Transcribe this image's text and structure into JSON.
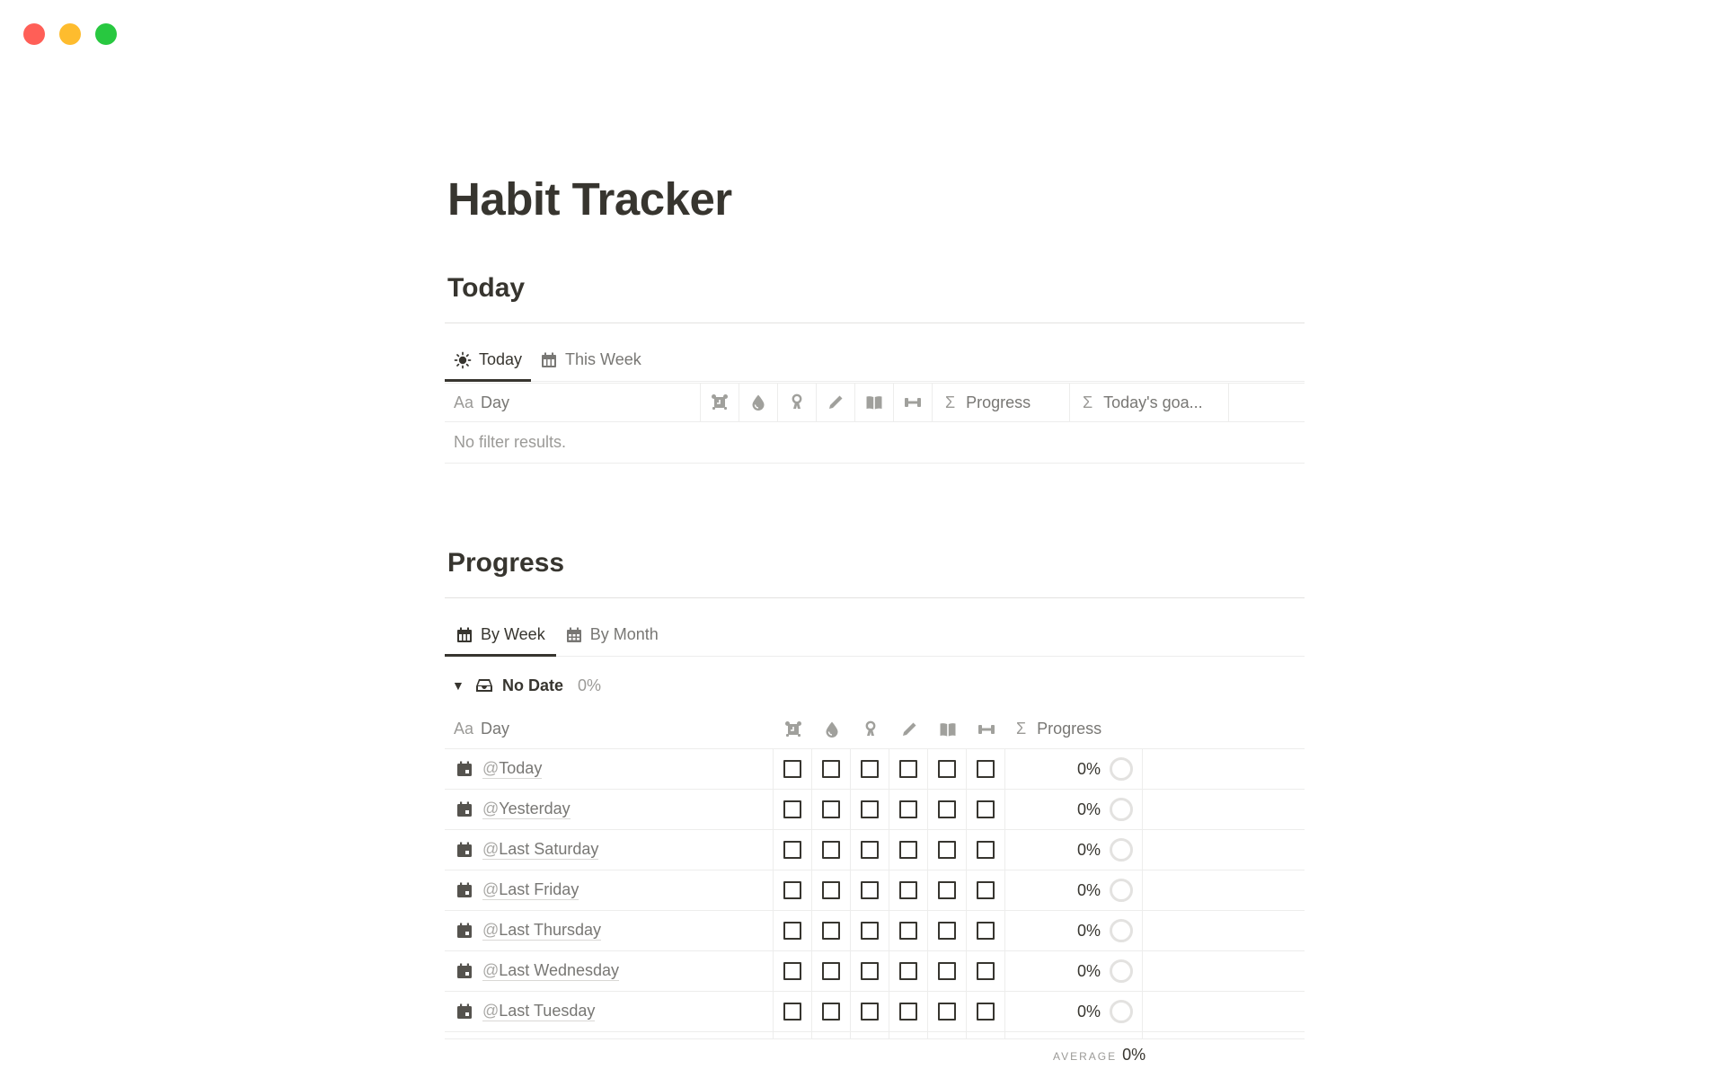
{
  "window": {
    "controls": [
      {
        "name": "close",
        "color": "#ff5f57"
      },
      {
        "name": "minimize",
        "color": "#febc2e"
      },
      {
        "name": "zoom",
        "color": "#28c840"
      }
    ]
  },
  "page": {
    "title": "Habit Tracker"
  },
  "today_section": {
    "heading": "Today",
    "tabs": [
      {
        "label": "Today",
        "icon": "sun-icon",
        "active": true
      },
      {
        "label": "This Week",
        "icon": "calendar-week-icon",
        "active": false
      }
    ],
    "columns": {
      "day_prefix": "Aa",
      "day": "Day",
      "habit_icons": [
        "alarm-clock-icon",
        "water-drop-icon",
        "meditation-icon",
        "pencil-icon",
        "book-icon",
        "dumbbell-icon"
      ],
      "progress_symbol": "Σ",
      "progress": "Progress",
      "goal_symbol": "Σ",
      "goal": "Today's goa..."
    },
    "empty_text": "No filter results."
  },
  "progress_section": {
    "heading": "Progress",
    "tabs": [
      {
        "label": "By Week",
        "icon": "calendar-week-icon",
        "active": true
      },
      {
        "label": "By Month",
        "icon": "calendar-month-icon",
        "active": false
      }
    ],
    "group": {
      "caret": "▼",
      "icon": "inbox-icon",
      "name": "No Date",
      "percent": "0%"
    },
    "columns": {
      "day_prefix": "Aa",
      "day": "Day",
      "habit_icons": [
        "alarm-clock-icon",
        "water-drop-icon",
        "meditation-icon",
        "pencil-icon",
        "book-icon",
        "dumbbell-icon"
      ],
      "progress_symbol": "Σ",
      "progress": "Progress"
    },
    "rows": [
      {
        "at": "@",
        "day": "Today",
        "checks": [
          false,
          false,
          false,
          false,
          false,
          false
        ],
        "progress": "0%"
      },
      {
        "at": "@",
        "day": "Yesterday",
        "checks": [
          false,
          false,
          false,
          false,
          false,
          false
        ],
        "progress": "0%"
      },
      {
        "at": "@",
        "day": "Last Saturday",
        "checks": [
          false,
          false,
          false,
          false,
          false,
          false
        ],
        "progress": "0%"
      },
      {
        "at": "@",
        "day": "Last Friday",
        "checks": [
          false,
          false,
          false,
          false,
          false,
          false
        ],
        "progress": "0%"
      },
      {
        "at": "@",
        "day": "Last Thursday",
        "checks": [
          false,
          false,
          false,
          false,
          false,
          false
        ],
        "progress": "0%"
      },
      {
        "at": "@",
        "day": "Last Wednesday",
        "checks": [
          false,
          false,
          false,
          false,
          false,
          false
        ],
        "progress": "0%"
      },
      {
        "at": "@",
        "day": "Last Tuesday",
        "checks": [
          false,
          false,
          false,
          false,
          false,
          false
        ],
        "progress": "0%"
      }
    ],
    "average": {
      "label": "AVERAGE",
      "value": "0%"
    }
  }
}
